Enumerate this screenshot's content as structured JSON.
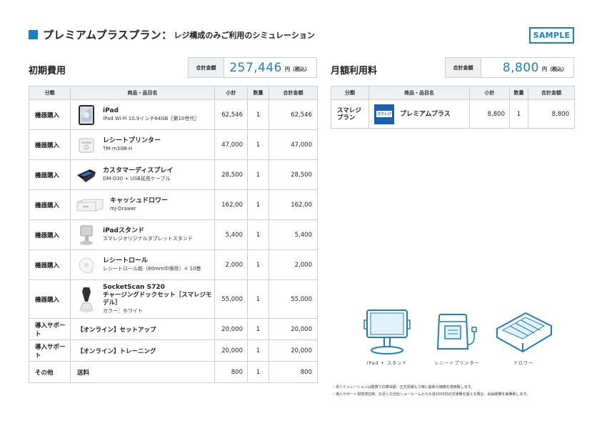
{
  "header": {
    "title": "プレミアムプラスプラン：",
    "subtitle": "レジ構成のみご利用のシミュレーション",
    "badge": "SAMPLE",
    "accent_color": "#1a7fc1"
  },
  "initial": {
    "section_title": "初期費用",
    "total_label": "合計金額",
    "total_amount": "257,446",
    "total_unit": "円（税込）",
    "columns": [
      "分類",
      "商品・品目名",
      "小計",
      "数量",
      "合計金額"
    ],
    "rows": [
      {
        "category": "機器購入",
        "icon": "ipad-icon",
        "name": "iPad",
        "spec": "iPad Wi-Fi 10.9インチ64GB［第10世代］",
        "subtotal": "62,546",
        "qty": "1",
        "total": "62,546"
      },
      {
        "category": "機器購入",
        "icon": "receipt-printer-icon",
        "name": "レシートプリンター",
        "spec": "TM-m30Ⅲ-H",
        "subtotal": "47,000",
        "qty": "1",
        "total": "47,000"
      },
      {
        "category": "機器購入",
        "icon": "customer-display-icon",
        "name": "カスタマーディスプレイ",
        "spec": "DM-D30 + USB延長ケーブル",
        "subtotal": "28,500",
        "qty": "1",
        "total": "28,500"
      },
      {
        "category": "機器購入",
        "icon": "cash-drawer-icon",
        "name": "キャッシュドロワー",
        "spec": "mJ-Drawer",
        "subtotal": "162,00",
        "qty": "1",
        "total": "162,00"
      },
      {
        "category": "機器購入",
        "icon": "ipad-stand-icon",
        "name": "iPadスタンド",
        "spec": "スマレジオリジナルタブレットスタンド",
        "subtotal": "5,400",
        "qty": "1",
        "total": "5,400"
      },
      {
        "category": "機器購入",
        "icon": "receipt-roll-icon",
        "name": "レシートロール",
        "spec": "レシートロール紙（80mm中保存）× 10巻",
        "subtotal": "2,000",
        "qty": "1",
        "total": "2,000"
      },
      {
        "category": "機器購入",
        "icon": "barcode-scanner-icon",
        "name": "SocketScan S720",
        "name2": "チャージングドックセット［スマレジモデル］",
        "spec": "カラー：ホワイト",
        "subtotal": "55,000",
        "qty": "1",
        "total": "55,000"
      },
      {
        "category": "導入サポート",
        "name": "【オンライン】セットアップ",
        "subtotal": "20,000",
        "qty": "1",
        "total": "20,000"
      },
      {
        "category": "導入サポート",
        "name": "【オンライン】トレーニング",
        "subtotal": "20,000",
        "qty": "1",
        "total": "20,000"
      },
      {
        "category": "その他",
        "name": "送料",
        "subtotal": "800",
        "qty": "1",
        "total": "800"
      }
    ]
  },
  "monthly": {
    "section_title": "月額利用料",
    "total_label": "合計金額",
    "total_amount": "8,800",
    "total_unit": "円（税込）",
    "columns": [
      "分類",
      "商品・品目名",
      "小計",
      "数量",
      "合計金額"
    ],
    "rows": [
      {
        "category": "スマレジプラン",
        "logo_text": "スマレジ",
        "name": "プレミアムプラス",
        "subtotal": "8,800",
        "qty": "1",
        "total": "8,800"
      }
    ]
  },
  "illustrations": {
    "labels": [
      "iPad + スタンド",
      "レシートプリンター",
      "ドロワー"
    ]
  },
  "notes": [
    "・本シミュレーションは概算での算出額、正式見積もり時に最新の価格を適用致します。",
    "・導入サポート現地滞在時、お近くの当社ショールームから片道1500円の交通費を超える場合、出張経費を実費致します。"
  ]
}
